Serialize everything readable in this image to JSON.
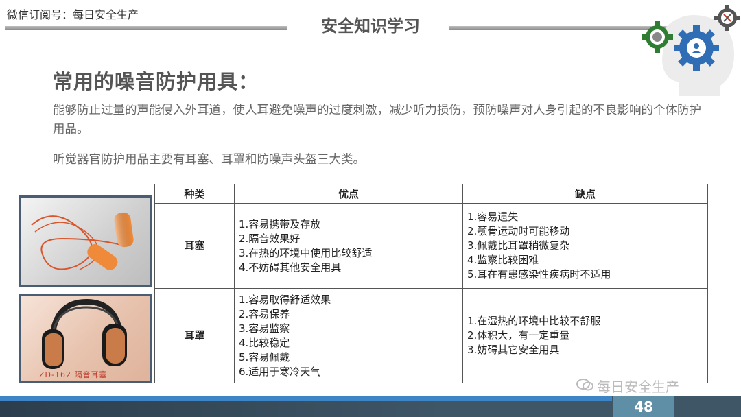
{
  "header": {
    "subscription": "微信订阅号：每日安全生产",
    "title": "安全知识学习"
  },
  "section": {
    "heading": "常用的噪音防护用具：",
    "paragraph1": "能够防止过量的声能侵入外耳道，使人耳避免噪声的过度刺激，减少听力损伤，预防噪声对人身引起的不良影响的个体防护用品。",
    "paragraph2": "听觉器官防护用品主要有耳塞、耳罩和防噪声头盔三大类。"
  },
  "images": {
    "earplug": {
      "icon": "earplug-photo"
    },
    "earmuff": {
      "icon": "earmuff-photo",
      "caption": "ZD-162 隔音耳塞"
    }
  },
  "table": {
    "headers": [
      "种类",
      "优点",
      "缺点"
    ],
    "rows": [
      {
        "kind": "耳塞",
        "pros": [
          "1.容易携带及存放",
          "2.隔音效果好",
          "3.在热的环境中使用比较舒适",
          "4.不妨碍其他安全用具"
        ],
        "cons": [
          "1.容易遗失",
          "2.颚骨运动时可能移动",
          "3.佩戴比耳罩稍微复杂",
          "4.监察比较困难",
          "5.耳在有患感染性疾病时不适用"
        ]
      },
      {
        "kind": "耳罩",
        "pros": [
          "1.容易取得舒适效果",
          "2.容易保养",
          "3.容易监察",
          "4.比较稳定",
          "5.容易佩戴",
          "6.适用于寒冷天气"
        ],
        "cons": [
          "1.在湿热的环境中比较不舒服",
          "2.体积大，有一定重量",
          "3.妨碍其它安全用具"
        ]
      }
    ]
  },
  "footer": {
    "watermark": "每日安全生产",
    "page_number": "48"
  },
  "colors": {
    "footer_dark": "#2c3e4d",
    "footer_blue": "#3d85c6",
    "page_box": "#5e8fa6",
    "gear_blue": "#2f6eb5",
    "gear_green": "#2e7d32"
  }
}
